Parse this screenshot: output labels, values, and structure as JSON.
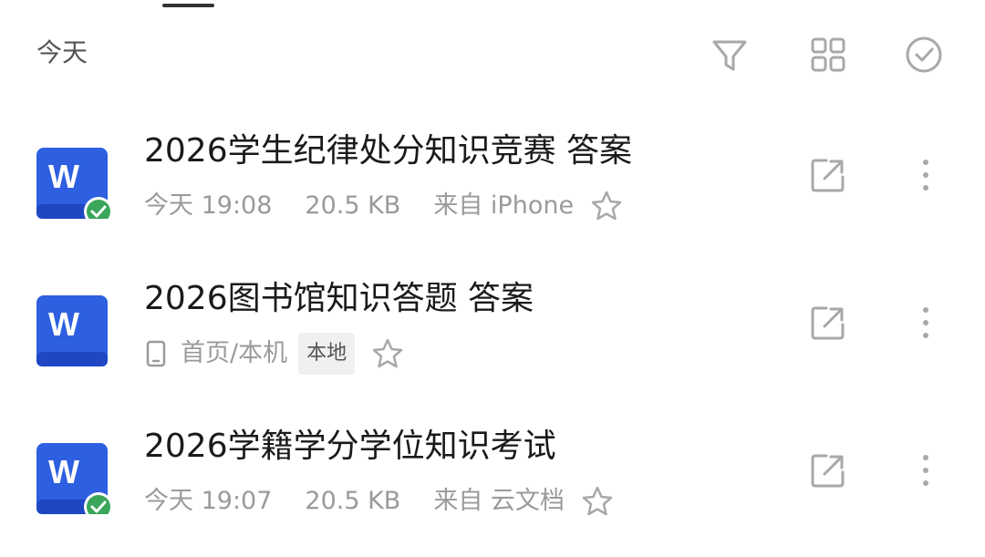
{
  "header": {
    "title": "今天",
    "filter_icon": "filter-icon",
    "grid_icon": "grid-view-icon",
    "select_icon": "select-check-icon"
  },
  "files": [
    {
      "title": "2026学生纪律处分知识竞赛 答案",
      "type_badge": "W",
      "synced": true,
      "time": "今天 19:08",
      "size": "20.5 KB",
      "source": "来自 iPhone",
      "starred": false
    },
    {
      "title": "2026图书馆知识答题 答案",
      "type_badge": "W",
      "synced": false,
      "location": "首页/本机",
      "tag": "本地",
      "starred": false
    },
    {
      "title": "2026学籍学分学位知识考试",
      "type_badge": "W",
      "synced": true,
      "time": "今天 19:07",
      "size": "20.5 KB",
      "source": "来自 云文档",
      "starred": false
    }
  ],
  "colors": {
    "word_blue": "#2d5fe0",
    "word_blue_dark": "#1f47c4",
    "sync_green": "#3aa65a",
    "icon_gray": "#a8a8a8"
  }
}
